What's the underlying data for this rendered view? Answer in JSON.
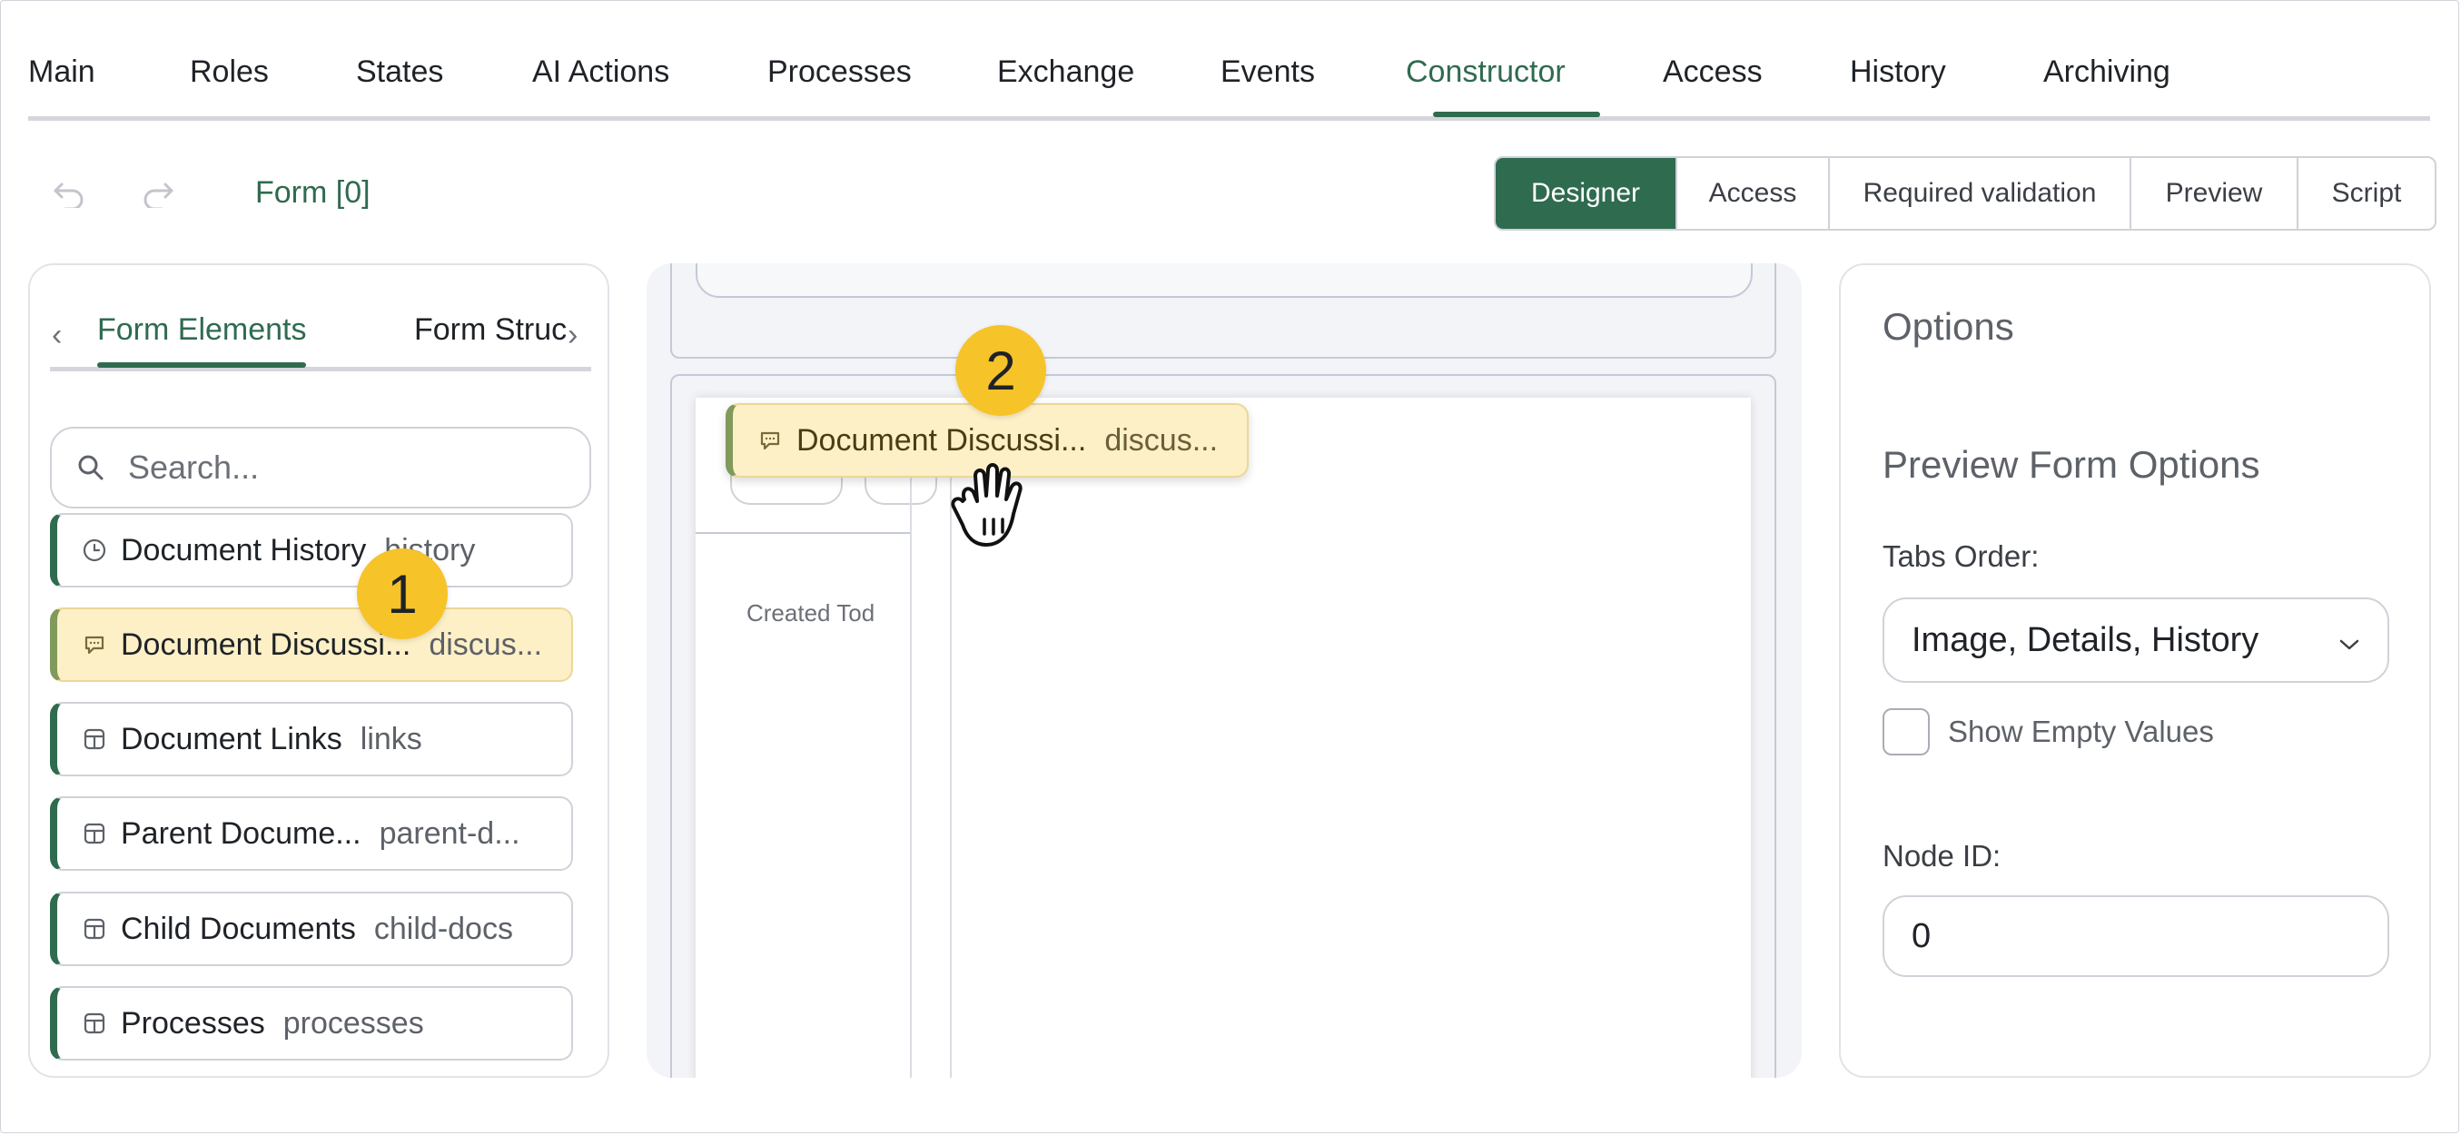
{
  "top_tabs": [
    "Main",
    "Roles",
    "States",
    "AI Actions",
    "Processes",
    "Exchange",
    "Events",
    "Constructor",
    "Access",
    "History",
    "Archiving"
  ],
  "active_top_tab": "Constructor",
  "toolbar": {
    "undo_icon": "undo-icon",
    "redo_icon": "redo-icon",
    "form_title": "Form [0]",
    "modes": [
      "Designer",
      "Access",
      "Required validation",
      "Preview",
      "Script"
    ],
    "active_mode": "Designer"
  },
  "left_panel": {
    "tabs": [
      "Form Elements",
      "Form Struc"
    ],
    "active_tab": "Form Elements",
    "search_placeholder": "Search...",
    "items": [
      {
        "name": "Document History",
        "key": "history",
        "icon": "clock-icon"
      },
      {
        "name": "Document Discussi...",
        "key": "discus...",
        "icon": "comment-icon",
        "highlighted": true
      },
      {
        "name": "Document Links",
        "key": "links",
        "icon": "table-icon"
      },
      {
        "name": "Parent Docume...",
        "key": "parent-d...",
        "icon": "table-icon"
      },
      {
        "name": "Child Documents",
        "key": "child-docs",
        "icon": "table-icon"
      },
      {
        "name": "Processes",
        "key": "processes",
        "icon": "table-icon"
      }
    ]
  },
  "canvas": {
    "preview_created_text": "Created Tod",
    "drag_item": {
      "name": "Document Discussi...",
      "key": "discus..."
    }
  },
  "right_panel": {
    "title": "Options",
    "subtitle": "Preview Form Options",
    "tabs_order_label": "Tabs Order:",
    "tabs_order_value": "Image, Details, History",
    "show_empty_label": "Show Empty Values",
    "show_empty_checked": false,
    "node_id_label": "Node ID:",
    "node_id_value": "0"
  },
  "annotations": {
    "badge1": "1",
    "badge2": "2"
  },
  "colors": {
    "accent": "#2f6b4f",
    "highlight": "#fdf0c6",
    "badge": "#f6c329"
  }
}
